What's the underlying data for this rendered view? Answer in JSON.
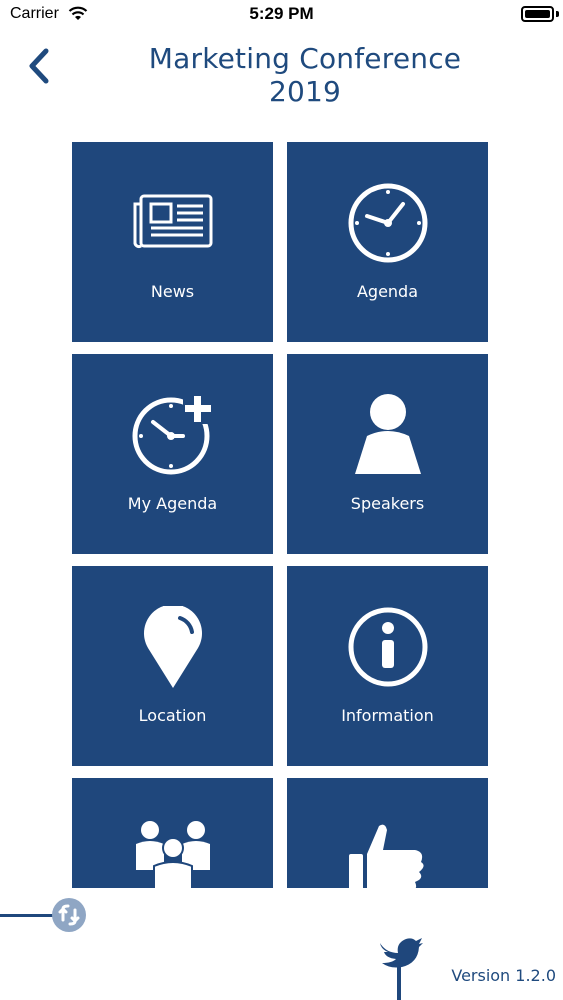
{
  "status_bar": {
    "carrier": "Carrier",
    "time": "5:29 PM",
    "icons": [
      "wifi-icon",
      "battery-icon"
    ]
  },
  "header": {
    "title": "Marketing Conference 2019",
    "back_icon": "chevron-left-icon"
  },
  "tiles": [
    {
      "label": "News",
      "icon": "newspaper-icon"
    },
    {
      "label": "Agenda",
      "icon": "clock-icon"
    },
    {
      "label": "My Agenda",
      "icon": "clock-plus-icon"
    },
    {
      "label": "Speakers",
      "icon": "person-icon"
    },
    {
      "label": "Location",
      "icon": "map-pin-icon"
    },
    {
      "label": "Information",
      "icon": "info-icon"
    },
    {
      "label": "",
      "icon": "people-group-icon"
    },
    {
      "label": "",
      "icon": "thumbs-up-icon"
    }
  ],
  "footer": {
    "refresh_icon": "refresh-icon",
    "social_icon": "twitter-bird-icon",
    "version": "Version 1.2.0"
  },
  "colors": {
    "tile": "#1f477c",
    "title": "#1f4a7e",
    "background": "#ffffff"
  }
}
